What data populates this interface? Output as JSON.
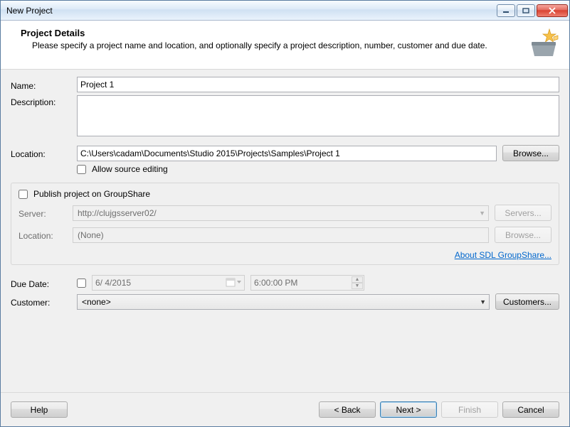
{
  "window": {
    "title": "New Project"
  },
  "header": {
    "title": "Project Details",
    "subtitle": "Please specify a project name and location, and optionally specify a project description, number, customer and due date."
  },
  "form": {
    "name_label": "Name:",
    "name_value": "Project 1",
    "description_label": "Description:",
    "description_value": "",
    "location_label": "Location:",
    "location_value": "C:\\Users\\cadam\\Documents\\Studio 2015\\Projects\\Samples\\Project 1",
    "browse_label": "Browse...",
    "allow_source_editing_label": "Allow source editing",
    "allow_source_editing_checked": false
  },
  "groupshare": {
    "publish_label": "Publish project on GroupShare",
    "publish_checked": false,
    "server_label": "Server:",
    "server_value": "http://clujgsserver02/",
    "servers_button": "Servers...",
    "location_label": "Location:",
    "location_value": "(None)",
    "browse_button": "Browse...",
    "about_link": "About SDL GroupShare..."
  },
  "schedule": {
    "due_date_label": "Due Date:",
    "due_date_enabled": false,
    "due_date_value": " 6/  4/2015",
    "due_time_value": "6:00:00 PM",
    "customer_label": "Customer:",
    "customer_value": "<none>",
    "customers_button": "Customers..."
  },
  "footer": {
    "help": "Help",
    "back": "< Back",
    "next": "Next >",
    "finish": "Finish",
    "cancel": "Cancel"
  }
}
